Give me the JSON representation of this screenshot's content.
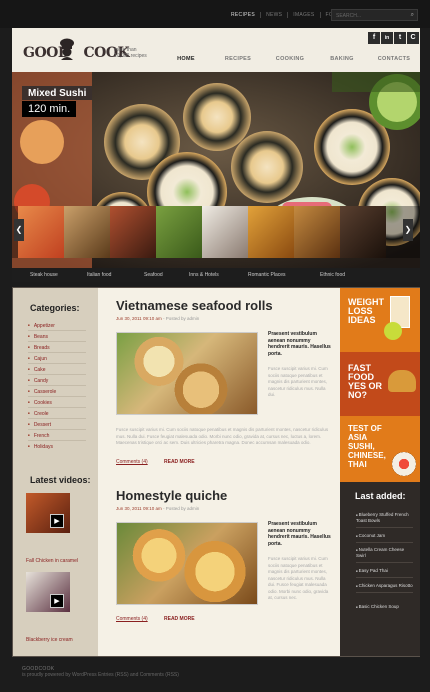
{
  "topbar": {
    "links": [
      "RECIPES",
      "NEWS",
      "IMAGES",
      "FORUM"
    ],
    "search_placeholder": "SEARCH..."
  },
  "header": {
    "logo_part1": "GOOD",
    "logo_part2": "COOK",
    "tagline_line1": "more than",
    "tagline_line2": "10,000 recipes",
    "social": [
      "f",
      "in",
      "t",
      "C"
    ],
    "nav": [
      "HOME",
      "RECIPES",
      "COOKING",
      "BAKING",
      "CONTACTS"
    ]
  },
  "hero": {
    "title": "Mixed Sushi",
    "time": "120 min.",
    "prev_arrow": "❮",
    "next_arrow": "❯"
  },
  "categories_bar": [
    "Steak house",
    "Italian food",
    "Seafood",
    "Inns & Hotels",
    "Romantic Places",
    "Ethnic food"
  ],
  "sidebar": {
    "categories_title": "Categories:",
    "categories": [
      "Appetizer",
      "Beans",
      "Breads",
      "Cajun",
      "Cake",
      "Candy",
      "Casserole",
      "Cookies",
      "Creole",
      "Dessert",
      "French",
      "Holidays"
    ],
    "videos_title": "Latest videos:",
    "videos": [
      "Fall Chicken in caramel",
      "Blackberry ice cream"
    ],
    "play_symbol": "▶"
  },
  "posts": [
    {
      "title": "Vietnamese seafood rolls",
      "meta_date": "Jun 30, 2011 09:10 am",
      "meta_author": "- Posted by admin",
      "bold_text": "Praesent vestibulum aenean nonummy hendrerit mauris. Hasellus porta.",
      "side_text": "Fusce suscipit varius mi. Cum sociis natoque penatibus et magnis dis parturient montes, nascetur ridiculus mus. Nulla dui.",
      "full_text": "Fusce suscipit varius mi. Cum sociis natoque penatibus et magnis dis parturient montes, nascetur ridiculus mus. Nulla dui. Fusce feugiat malesuada odio. Morbi nunc odio, gravida at, cursus nec, luctus a, lorem. Maecenas tristique orci ac sem. Duis ultricies pharetra magna. Donec accumsan malesuada odio.",
      "comments": "Comments (4)",
      "read_more": "READ MORE"
    },
    {
      "title": "Homestyle quiche",
      "meta_date": "Jun 30, 2011 09:10 am",
      "meta_author": "- Posted by admin",
      "bold_text": "Praesent vestibulum aenean nonummy hendrerit mauris. Hasellus porta.",
      "side_text": "Fusce suscipit varius mi. Cum sociis natoque penatibus et magnis dis parturient montes, nascetur ridiculus mus. Nulla dui. Fusce feugiat malesuada odio. Morbi nunc odio, gravida at, cursus nec.",
      "comments": "Comments (4)",
      "read_more": "READ MORE"
    }
  ],
  "promos": [
    {
      "text": "WEIGHT LOSS IDEAS",
      "color": "#e17b1a"
    },
    {
      "text": "FAST FOOD YES OR NO?",
      "color": "#c24a1a"
    },
    {
      "text": "TEST OF ASIA SUSHI, CHINESE, THAI",
      "color": "#e17b1a"
    }
  ],
  "last_added": {
    "title": "Last added:",
    "items": [
      "Blueberry Stuffed French Toast Bowls",
      "Coconut Jam",
      "Nutella Cream Cheese Swirl",
      "Easy Pad Thai",
      "Chicken Asparagus Risotto",
      "Basic Chicken Soup"
    ]
  },
  "footer": {
    "brand": "GOODCOOK",
    "text": "is proudly powered by WordPress Entries (RSS) and Comments (RSS)"
  }
}
